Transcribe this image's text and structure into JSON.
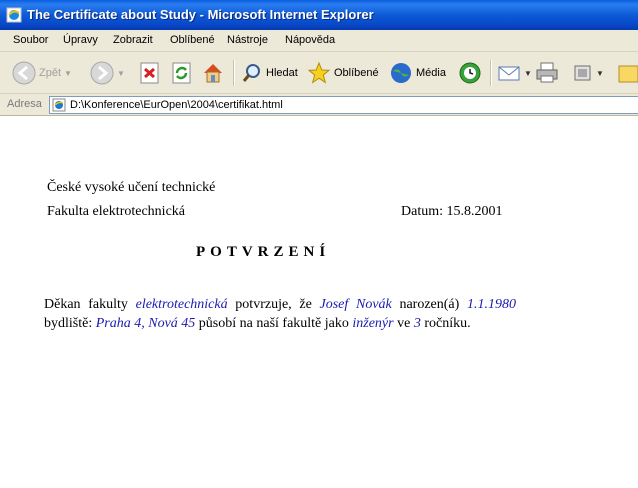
{
  "window": {
    "title": "The Certificate about Study - Microsoft Internet Explorer"
  },
  "menu": [
    "Soubor",
    "Úpravy",
    "Zobrazit",
    "Oblíbené",
    "Nástroje",
    "Nápověda"
  ],
  "toolbar": {
    "back_label": "Zpět",
    "search_label": "Hledat",
    "favorites_label": "Oblíbené",
    "media_label": "Média"
  },
  "address": {
    "label": "Adresa",
    "value": "D:\\Konference\\EurOpen\\2004\\certifikat.html"
  },
  "page": {
    "university": "České vysoké učení technické",
    "faculty": "Fakulta elektrotechnická",
    "date": "Datum: 15.8.2001",
    "heading": "POTVRZENÍ",
    "para": {
      "t1": "Děkan fakulty ",
      "faculty_name": "elektrotechnická",
      "t2": " potvrzuje, že ",
      "student_name": "Josef Novák",
      "t3": " narozen(á) ",
      "birth_date": "1.1.1980",
      "t4": " bydliště: ",
      "address": "Praha 4, Nová 45",
      "t5": " působí na naší fakultě jako ",
      "role": "inženýr",
      "t6": " ve ",
      "year": "3",
      "t7": " ročníku."
    }
  }
}
